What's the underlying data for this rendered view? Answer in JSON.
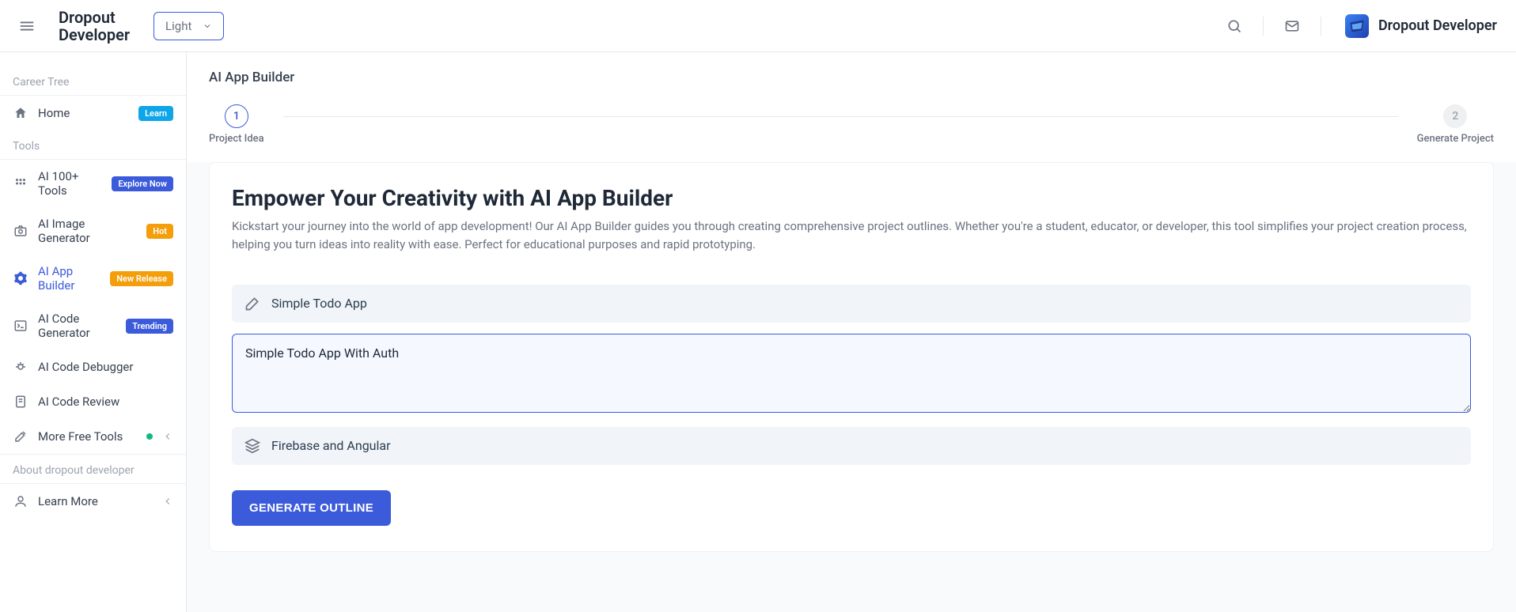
{
  "header": {
    "brand_line1": "Dropout",
    "brand_line2": "Developer",
    "theme_label": "Light",
    "user_name": "Dropout Developer"
  },
  "sidebar": {
    "section_career": "Career Tree",
    "section_tools": "Tools",
    "section_about": "About dropout developer",
    "items": {
      "home": {
        "label": "Home",
        "badge": "Learn"
      },
      "tools100": {
        "label": "AI 100+ Tools",
        "badge": "Explore Now"
      },
      "imagegen": {
        "label": "AI Image Generator",
        "badge": "Hot"
      },
      "appbuilder": {
        "label": "AI App Builder",
        "badge": "New Release"
      },
      "codegen": {
        "label": "AI Code Generator",
        "badge": "Trending"
      },
      "debugger": {
        "label": "AI Code Debugger"
      },
      "review": {
        "label": "AI Code Review"
      },
      "morefree": {
        "label": "More Free Tools"
      },
      "learnmore": {
        "label": "Learn More"
      }
    }
  },
  "main": {
    "breadcrumb": "AI App Builder",
    "steps": {
      "s1": {
        "num": "1",
        "label": "Project Idea"
      },
      "s2": {
        "num": "2",
        "label": "Generate Project"
      }
    },
    "hero_title": "Empower Your Creativity with AI App Builder",
    "hero_sub": "Kickstart your journey into the world of app development! Our AI App Builder guides you through creating comprehensive project outlines. Whether you're a student, educator, or developer, this tool simplifies your project creation process, helping you turn ideas into reality with ease. Perfect for educational purposes and rapid prototyping.",
    "field_name_value": "Simple Todo App",
    "field_desc_value": "Simple Todo App With Auth",
    "field_stack_value": "Firebase and Angular",
    "generate_btn": "GENERATE OUTLINE"
  }
}
